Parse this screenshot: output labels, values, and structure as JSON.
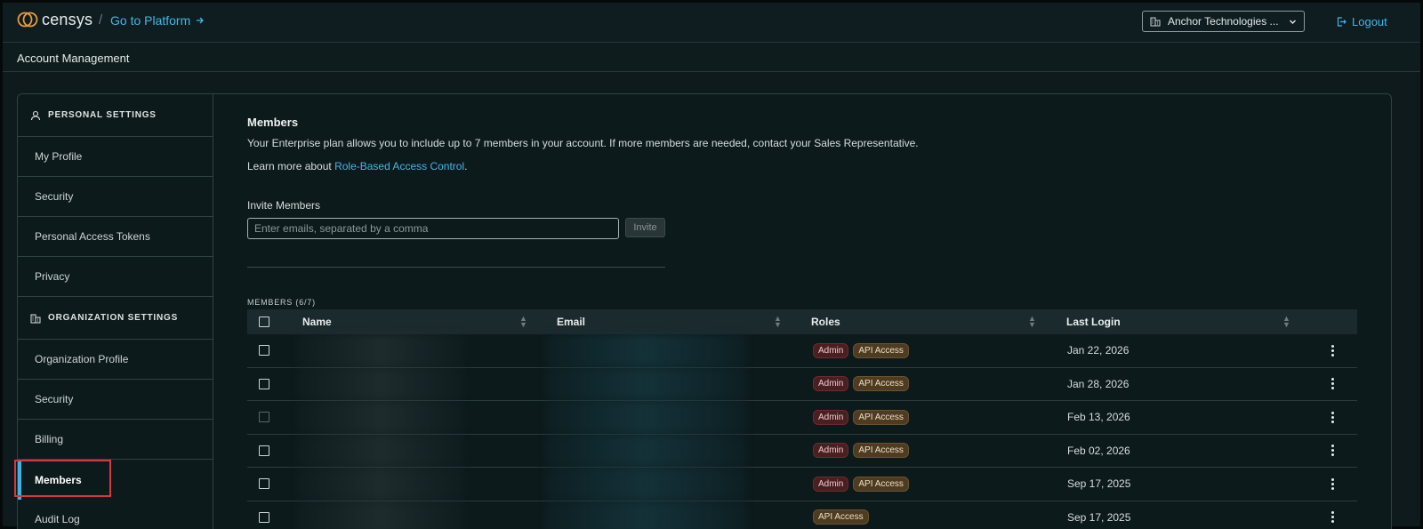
{
  "header": {
    "logo_text": "censys",
    "separator": "/",
    "goto_label": "Go to Platform",
    "org_name": "Anchor Technologies ...",
    "logout_label": "Logout"
  },
  "subheader": {
    "title": "Account Management"
  },
  "sidebar": {
    "personal_title": "PERSONAL SETTINGS",
    "personal_items": [
      "My Profile",
      "Security",
      "Personal Access Tokens",
      "Privacy"
    ],
    "org_title": "ORGANIZATION SETTINGS",
    "org_items": [
      "Organization Profile",
      "Security",
      "Billing"
    ],
    "active_item": "Members",
    "next_item": "Audit Log"
  },
  "content": {
    "title": "Members",
    "description": "Your Enterprise plan allows you to include up to 7 members in your account. If more members are needed, contact your Sales Representative.",
    "learn_prefix": "Learn more about ",
    "learn_link": "Role-Based Access Control",
    "learn_suffix": ".",
    "invite_label": "Invite Members",
    "invite_placeholder": "Enter emails, separated by a comma",
    "invite_button": "Invite",
    "count_label": "MEMBERS (6/7)"
  },
  "table": {
    "columns": [
      "Name",
      "Email",
      "Roles",
      "Last Login"
    ],
    "rows": [
      {
        "roles": [
          "Admin",
          "API Access"
        ],
        "last_login": "Jan 22, 2026"
      },
      {
        "roles": [
          "Admin",
          "API Access"
        ],
        "last_login": "Jan 28, 2026"
      },
      {
        "roles": [
          "Admin",
          "API Access"
        ],
        "last_login": "Feb 13, 2026"
      },
      {
        "roles": [
          "Admin",
          "API Access"
        ],
        "last_login": "Feb 02, 2026"
      },
      {
        "roles": [
          "Admin",
          "API Access"
        ],
        "last_login": "Sep 17, 2025"
      },
      {
        "roles": [
          "API Access"
        ],
        "last_login": "Sep 17, 2025"
      }
    ]
  },
  "colors": {
    "accent": "#42b6e8",
    "highlight_box": "#d9363e",
    "logo_orange": "#e89a3c"
  }
}
